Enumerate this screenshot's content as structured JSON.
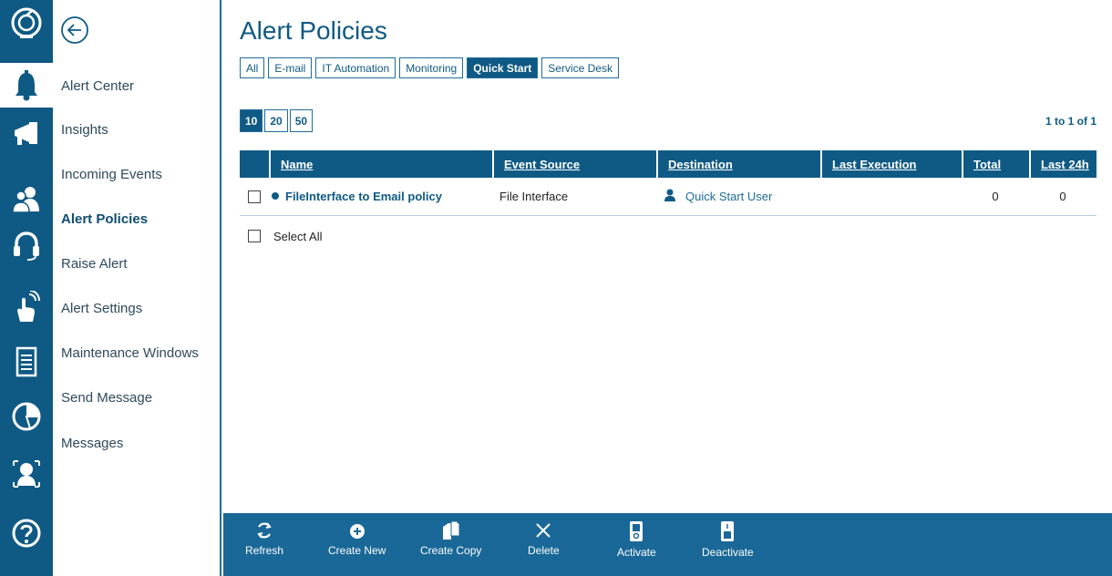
{
  "page": {
    "title": "Alert Policies"
  },
  "colors": {
    "brand": "#0f5a84",
    "toolbar": "#1a6898",
    "accent": "#1f6d99"
  },
  "rail": {
    "icons": [
      "logo-icon",
      "bell-icon",
      "megaphone-icon",
      "users-icon",
      "headset-icon",
      "touch-icon",
      "server-icon",
      "pie-chart-icon",
      "person-frame-icon",
      "help-icon"
    ],
    "active_index": 1
  },
  "subnav": {
    "items": [
      {
        "label": "Alert Center"
      },
      {
        "label": "Insights"
      },
      {
        "label": "Incoming Events"
      },
      {
        "label": "Alert Policies"
      },
      {
        "label": "Raise Alert"
      },
      {
        "label": "Alert Settings"
      },
      {
        "label": "Maintenance Windows"
      },
      {
        "label": "Send Message"
      },
      {
        "label": "Messages"
      }
    ],
    "active_label": "Alert Policies"
  },
  "filters": [
    "All",
    "E-mail",
    "IT Automation",
    "Monitoring",
    "Quick Start",
    "Service Desk"
  ],
  "active_filter": "Quick Start",
  "pager": {
    "sizes": [
      "10",
      "20",
      "50"
    ],
    "active": "10",
    "range": "1 to 1 of 1"
  },
  "table": {
    "columns": [
      "Name",
      "Event Source",
      "Destination",
      "Last Execution",
      "Total",
      "Last 24h"
    ],
    "rows": [
      {
        "name": "FileInterface to Email policy",
        "event_source": "File Interface",
        "destination": "Quick Start User",
        "last_execution": "",
        "total": "0",
        "last_24h": "0"
      }
    ],
    "select_all": "Select All"
  },
  "toolbar": {
    "items": [
      {
        "label": "Refresh",
        "icon": "refresh-icon"
      },
      {
        "label": "Create New",
        "icon": "plus-circle-icon"
      },
      {
        "label": "Create Copy",
        "icon": "copy-icon"
      },
      {
        "label": "Delete",
        "icon": "close-icon"
      },
      {
        "label": "Activate",
        "icon": "switch-on-icon"
      },
      {
        "label": "Deactivate",
        "icon": "switch-off-icon"
      }
    ]
  }
}
